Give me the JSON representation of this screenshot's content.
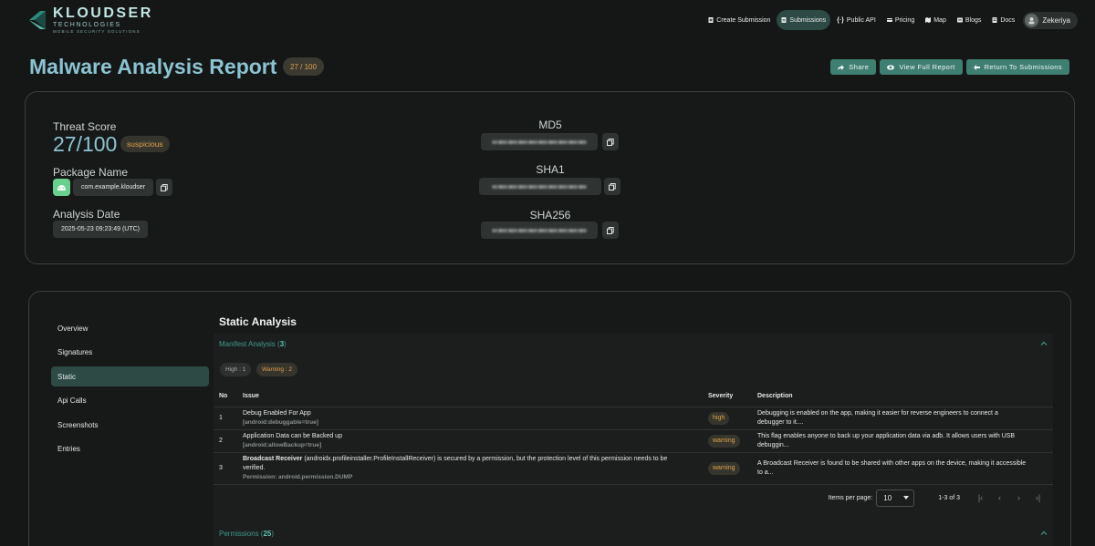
{
  "brand": {
    "name": "KLOUDSER",
    "sub": "TECHNOLOGIES",
    "tagline": "MOBILE SECURITY SOLUTIONS"
  },
  "nav": {
    "items": [
      {
        "label": "Create Submission",
        "icon": "file-plus-icon"
      },
      {
        "label": "Submissions",
        "icon": "file-icon",
        "active": true
      },
      {
        "label": "Public API",
        "icon": "code-icon"
      },
      {
        "label": "Pricing",
        "icon": "card-icon"
      },
      {
        "label": "Map",
        "icon": "map-icon"
      },
      {
        "label": "Blogs",
        "icon": "blog-icon"
      },
      {
        "label": "Docs",
        "icon": "doc-icon"
      }
    ],
    "user": "Zekeriya"
  },
  "header": {
    "title": "Malware Analysis Report",
    "score_badge": "27 / 100",
    "actions": {
      "share": "Share",
      "view_full": "View Full Report",
      "return": "Return To Submissions"
    }
  },
  "summary": {
    "threat_score_label": "Threat Score",
    "threat_score": "27/100",
    "verdict": "suspicious",
    "package_label": "Package Name",
    "package_name": "com.example.kloudser",
    "date_label": "Analysis Date",
    "date": "2025-05-23 09:23:49 (UTC)",
    "md5_label": "MD5",
    "sha1_label": "SHA1",
    "sha256_label": "SHA256"
  },
  "sidebar": {
    "items": [
      {
        "label": "Overview"
      },
      {
        "label": "Signatures"
      },
      {
        "label": "Static",
        "active": true
      },
      {
        "label": "Api Calls"
      },
      {
        "label": "Screenshots"
      },
      {
        "label": "Entries"
      }
    ]
  },
  "static": {
    "title": "Static Analysis",
    "manifest": {
      "label": "Manifest Analysis",
      "count": "3",
      "chips": [
        "High : 1",
        "Warning : 2"
      ],
      "columns": [
        "No",
        "Issue",
        "Severity",
        "Description"
      ],
      "rows": [
        {
          "no": "1",
          "issue_title": "Debug Enabled For App",
          "issue_prefix": "",
          "issue_sub": "[android:debuggable=true]",
          "severity": "high",
          "desc_line1": "Debugging is enabled on the app, making it easier for reverse engineers to connect a",
          "desc_line2": "debugger to it...."
        },
        {
          "no": "2",
          "issue_title": "Application Data can be Backed up",
          "issue_prefix": "",
          "issue_sub": "[android:allowBackup=true]",
          "severity": "warning",
          "desc_line1": "This flag enables anyone to back up your application data via adb. It allows users with USB",
          "desc_line2": "debuggin..."
        },
        {
          "no": "3",
          "issue_title": "(androidx.profileinstaller.ProfileInstallReceiver) is secured by a permission, but the protection level of this permission needs to be",
          "issue_title2": "verified.",
          "issue_prefix": "Broadcast Receiver",
          "issue_sub_label": "Permission:",
          "issue_sub": "android.permission.DUMP",
          "severity": "warning",
          "desc_line1": "A Broadcast Receiver is found to be shared with other apps on the device, making it accessible",
          "desc_line2": "to a..."
        }
      ],
      "paginator": {
        "items_per_page_label": "Items per page:",
        "items_per_page": "10",
        "range": "1-3 of 3"
      }
    },
    "permissions": {
      "label": "Permissions",
      "count": "25"
    }
  },
  "colors": {
    "accent": "#3f7f72",
    "title": "#8cc3d3",
    "warning": "#e0a24a",
    "active_bg": "#2d4a44"
  }
}
